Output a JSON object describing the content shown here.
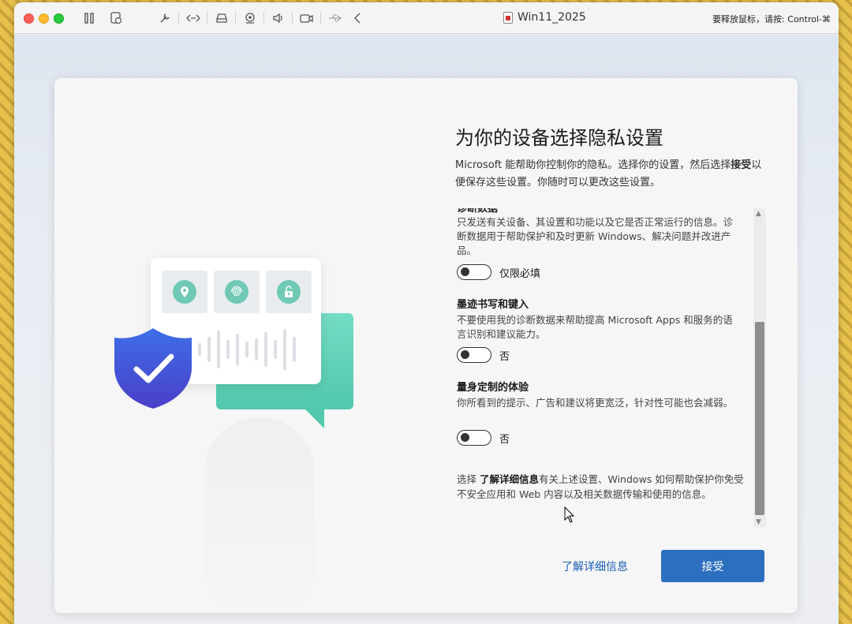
{
  "window": {
    "title": "Win11_2025",
    "release_hint": "要释放鼠标，请按: Control-⌘"
  },
  "toolbar": {
    "icons": [
      "pause-icon",
      "snapshot-icon",
      "settings-icon",
      "network-icon",
      "disk-icon",
      "camera-icon",
      "sound-icon",
      "video-icon",
      "usb-icon",
      "back-icon"
    ]
  },
  "page": {
    "title": "为你的设备选择隐私设置",
    "subtitle_part1": "Microsoft 能帮助你控制你的隐私。选择你的设置，然后选择",
    "subtitle_bold": "接受",
    "subtitle_part2": "以便保存这些设置。你随时可以更改这些设置。"
  },
  "sections": [
    {
      "title": "诊断数据",
      "desc": "只发送有关设备、其设置和功能以及它是否正常运行的信息。诊断数据用于帮助保护和及时更新 Windows、解决问题并改进产品。",
      "toggle_label": "仅限必填"
    },
    {
      "title": "墨迹书写和键入",
      "desc": "不要使用我的诊断数据来帮助提高 Microsoft Apps 和服务的语言识别和建议能力。",
      "toggle_label": "否"
    },
    {
      "title": "量身定制的体验",
      "desc": "你所看到的提示、广告和建议将更宽泛，针对性可能也会减弱。",
      "toggle_label": "否"
    }
  ],
  "info": {
    "prefix": "选择 ",
    "link": "了解详细信息",
    "suffix": "有关上述设置、Windows 如何帮助保护你免受不安全应用和 Web 内容以及相关数据传输和使用的信息。"
  },
  "buttons": {
    "learn_more": "了解详细信息",
    "accept": "接受"
  },
  "colors": {
    "accent": "#2b6fbe",
    "link": "#1a5fb4",
    "teal": "#5fd0b7",
    "shield": "#3b5bd9"
  }
}
